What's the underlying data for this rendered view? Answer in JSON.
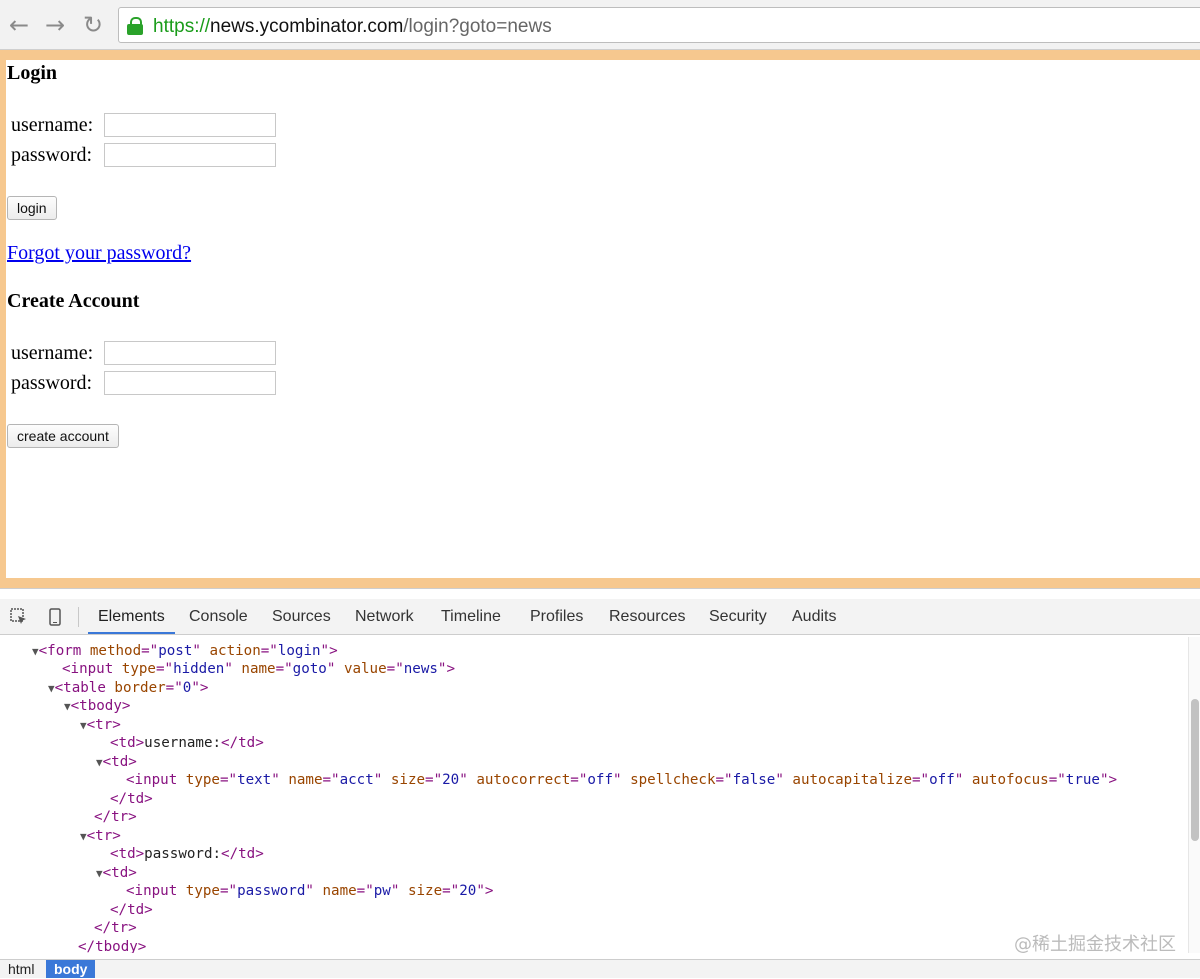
{
  "browser": {
    "url_scheme": "https://",
    "url_host": "news.ycombinator.com",
    "url_path": "/login?goto=news",
    "back_glyph": "←",
    "forward_glyph": "→",
    "reload_glyph": "↻"
  },
  "login": {
    "heading": "Login",
    "username_label": "username:",
    "password_label": "password:",
    "button": "login",
    "forgot_link": "Forgot your password?"
  },
  "create": {
    "heading": "Create Account",
    "username_label": "username:",
    "password_label": "password:",
    "button": "create account"
  },
  "devtools": {
    "tabs": [
      "Elements",
      "Console",
      "Sources",
      "Network",
      "Timeline",
      "Profiles",
      "Resources",
      "Security",
      "Audits"
    ],
    "active_tab": "Elements",
    "breadcrumbs": [
      "html",
      "body"
    ],
    "selected_crumb": "body",
    "watermark": "@稀土掘金技术社区",
    "accent_color": "#3a78d8"
  }
}
